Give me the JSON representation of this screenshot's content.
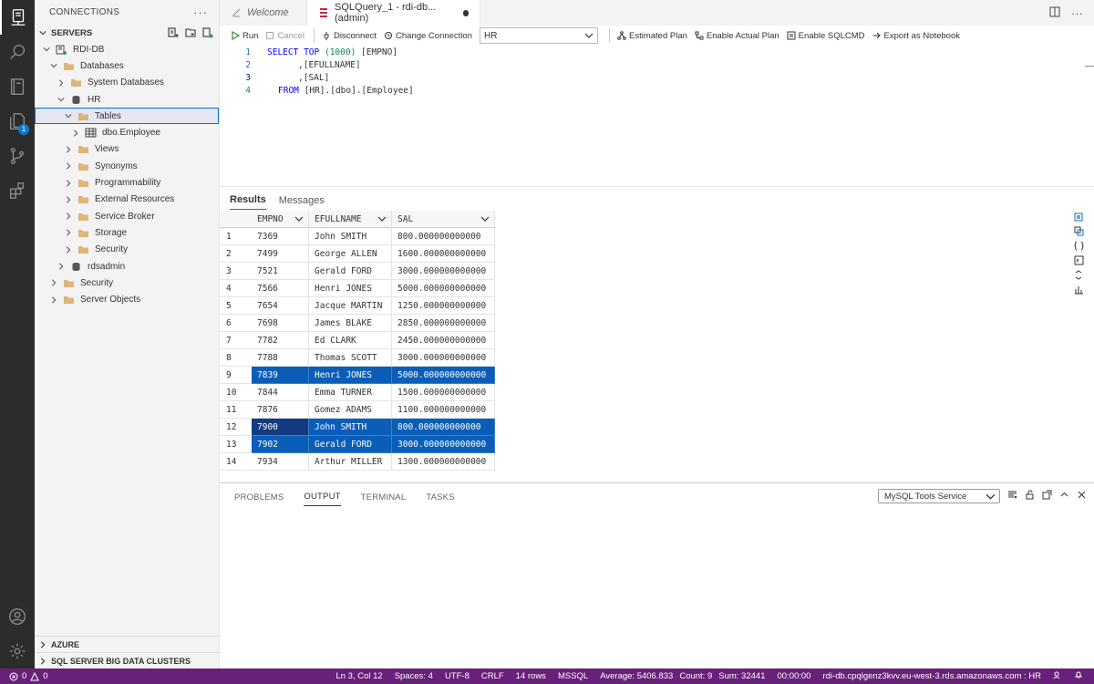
{
  "sidebar": {
    "title": "CONNECTIONS",
    "servers_label": "SERVERS",
    "tree": [
      {
        "label": "RDI-DB",
        "icon": "server-icon",
        "depth": 0,
        "expanded": true
      },
      {
        "label": "Databases",
        "icon": "folder-icon",
        "depth": 1,
        "expanded": true
      },
      {
        "label": "System Databases",
        "icon": "folder-icon",
        "depth": 2,
        "expanded": false
      },
      {
        "label": "HR",
        "icon": "database-icon",
        "depth": 2,
        "expanded": true
      },
      {
        "label": "Tables",
        "icon": "folder-icon",
        "depth": 3,
        "expanded": true,
        "selected": true
      },
      {
        "label": "dbo.Employee",
        "icon": "table-icon",
        "depth": 4,
        "expanded": false
      },
      {
        "label": "Views",
        "icon": "folder-icon",
        "depth": 3,
        "expanded": false
      },
      {
        "label": "Synonyms",
        "icon": "folder-icon",
        "depth": 3,
        "expanded": false
      },
      {
        "label": "Programmability",
        "icon": "folder-icon",
        "depth": 3,
        "expanded": false
      },
      {
        "label": "External Resources",
        "icon": "folder-icon",
        "depth": 3,
        "expanded": false
      },
      {
        "label": "Service Broker",
        "icon": "folder-icon",
        "depth": 3,
        "expanded": false
      },
      {
        "label": "Storage",
        "icon": "folder-icon",
        "depth": 3,
        "expanded": false
      },
      {
        "label": "Security",
        "icon": "folder-icon",
        "depth": 3,
        "expanded": false
      },
      {
        "label": "rdsadmin",
        "icon": "database-icon",
        "depth": 2,
        "expanded": false
      },
      {
        "label": "Security",
        "icon": "folder-icon",
        "depth": 1,
        "expanded": false
      },
      {
        "label": "Server Objects",
        "icon": "folder-icon",
        "depth": 1,
        "expanded": false
      }
    ],
    "azure_label": "AZURE",
    "bdc_label": "SQL SERVER BIG DATA CLUSTERS"
  },
  "activity": {
    "badge": "1"
  },
  "tabs": [
    {
      "label": "Welcome",
      "active": false
    },
    {
      "label": "SQLQuery_1 - rdi-db...(admin)",
      "active": true
    }
  ],
  "toolbar": {
    "run": "Run",
    "cancel": "Cancel",
    "disconnect": "Disconnect",
    "change_connection": "Change Connection",
    "database": "HR",
    "estimated_plan": "Estimated Plan",
    "actual_plan": "Enable Actual Plan",
    "sqlcmd": "Enable SQLCMD",
    "export_notebook": "Export as Notebook"
  },
  "code": {
    "line_numbers": [
      "1",
      "2",
      "3",
      "4"
    ],
    "l1_kw1": "SELECT",
    "l1_kw2": "TOP",
    "l1_num": "(1000)",
    "l1_rest": "[EMPNO]",
    "l2": ",[EFULLNAME]",
    "l3": ",[SAL]",
    "l4_kw": "FROM",
    "l4_rest": "[HR].[dbo].[Employee]"
  },
  "results": {
    "tab_results": "Results",
    "tab_messages": "Messages",
    "columns": [
      "EMPNO",
      "EFULLNAME",
      "SAL"
    ],
    "rows": [
      [
        "1",
        "7369",
        "John SMITH",
        "800.000000000000"
      ],
      [
        "2",
        "7499",
        "George ALLEN",
        "1600.000000000000"
      ],
      [
        "3",
        "7521",
        "Gerald FORD",
        "3000.000000000000"
      ],
      [
        "4",
        "7566",
        "Henri JONES",
        "5000.000000000000"
      ],
      [
        "5",
        "7654",
        "Jacque MARTIN",
        "1250.000000000000"
      ],
      [
        "6",
        "7698",
        "James BLAKE",
        "2850.000000000000"
      ],
      [
        "7",
        "7782",
        "Ed CLARK",
        "2450.000000000000"
      ],
      [
        "8",
        "7788",
        "Thomas SCOTT",
        "3000.000000000000"
      ],
      [
        "9",
        "7839",
        "Henri JONES",
        "5000.000000000000"
      ],
      [
        "10",
        "7844",
        "Emma TURNER",
        "1500.000000000000"
      ],
      [
        "11",
        "7876",
        "Gomez ADAMS",
        "1100.000000000000"
      ],
      [
        "12",
        "7900",
        "John SMITH",
        "800.000000000000"
      ],
      [
        "13",
        "7902",
        "Gerald FORD",
        "3000.000000000000"
      ],
      [
        "14",
        "7934",
        "Arthur MILLER",
        "1300.000000000000"
      ]
    ],
    "selected_rows": [
      9,
      12,
      13
    ]
  },
  "panel": {
    "tabs": [
      "PROBLEMS",
      "OUTPUT",
      "TERMINAL",
      "TASKS"
    ],
    "active_tab": "OUTPUT",
    "output_channel": "MySQL Tools Service"
  },
  "status": {
    "errors": "0",
    "warnings": "0",
    "position": "Ln 3, Col 12",
    "spaces": "Spaces: 4",
    "encoding": "UTF-8",
    "eol": "CRLF",
    "rows": "14 rows",
    "language": "MSSQL",
    "average": "Average: 5406.833",
    "count": "Count: 9",
    "sum": "Sum: 32441",
    "elapsed": "00:00:00",
    "connection": "rdi-db.cpqlgenz3kvv.eu-west-3.rds.amazonaws.com : HR"
  },
  "colors": {
    "status_bar": "#68217a",
    "selection": "#0a5eb8",
    "accent": "#0a6fcf"
  }
}
